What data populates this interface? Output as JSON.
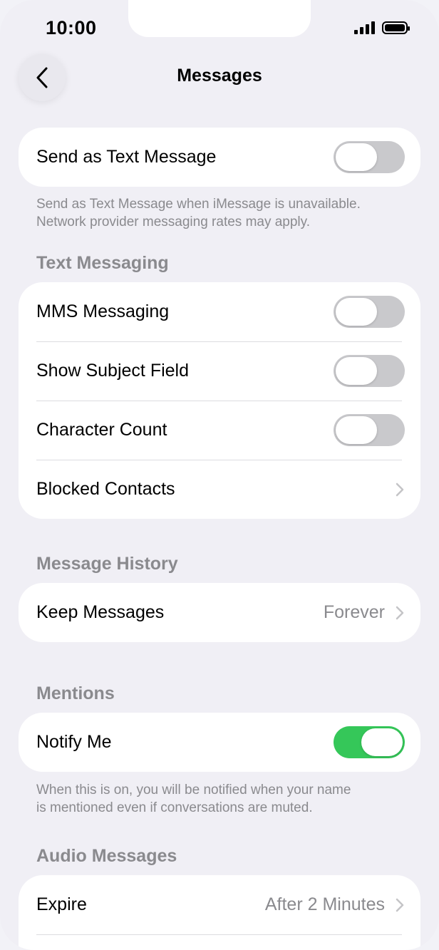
{
  "status_bar": {
    "time": "10:00"
  },
  "nav": {
    "title": "Messages"
  },
  "send_as_text": {
    "label": "Send as Text Message",
    "enabled": false,
    "footer_line1": "Send as Text Message when iMessage is unavailable.",
    "footer_line2": "Network provider messaging rates may apply."
  },
  "text_messaging": {
    "header": "Text Messaging",
    "items": [
      {
        "label": "MMS Messaging",
        "enabled": false
      },
      {
        "label": "Show Subject Field",
        "enabled": false
      },
      {
        "label": "Character Count",
        "enabled": false
      },
      {
        "label": "Blocked Contacts"
      }
    ]
  },
  "message_history": {
    "header": "Message History",
    "keep_messages_label": "Keep Messages",
    "keep_messages_value": "Forever"
  },
  "mentions": {
    "header": "Mentions",
    "notify_label": "Notify Me",
    "notify_enabled": true,
    "footer_line1": "When this is on, you will be notified when your name",
    "footer_line2": "is mentioned even if conversations are muted."
  },
  "audio_messages": {
    "header": "Audio Messages",
    "expire_label": "Expire",
    "expire_value": "After 2 Minutes"
  },
  "colors": {
    "toggle_on": "#35c759",
    "toggle_off": "#c9c9cc",
    "secondary_text": "#8a8a8e"
  }
}
